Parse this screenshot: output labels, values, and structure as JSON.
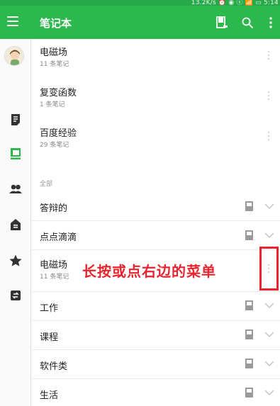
{
  "status_bar": {
    "text": "13.2K/s ⏰ ◉ ⓢ 📶 ▭ 5:14"
  },
  "app_bar": {
    "title": "笔记本",
    "icons": [
      "menu-icon",
      "notebook-icon",
      "search-icon",
      "more-vertical-icon"
    ]
  },
  "sidebar": {
    "items": [
      {
        "name": "avatar"
      },
      {
        "name": "notes-icon"
      },
      {
        "name": "notebooks-icon",
        "active": true
      },
      {
        "name": "group-icon"
      },
      {
        "name": "work-chat-icon"
      },
      {
        "name": "star-icon"
      },
      {
        "name": "sync-icon"
      }
    ]
  },
  "recent": [
    {
      "name": "电磁场",
      "count": "11 条笔记"
    },
    {
      "name": "复变函数",
      "count": "1 条笔记"
    },
    {
      "name": "百度经验",
      "count": "29 条笔记"
    }
  ],
  "all_section": {
    "label": "全部",
    "items": [
      {
        "name": "答辩的"
      },
      {
        "name": "点点滴滴"
      },
      {
        "name": "电磁场",
        "count": "11 条笔记"
      },
      {
        "name": "工作"
      },
      {
        "name": "课程"
      },
      {
        "name": "软件类"
      },
      {
        "name": "生活"
      }
    ]
  },
  "annotation": {
    "text": "长按或点右边的菜单"
  },
  "colors": {
    "accent": "#2db84d",
    "status_bar": "#26a948",
    "annotation": "#e8252f"
  }
}
